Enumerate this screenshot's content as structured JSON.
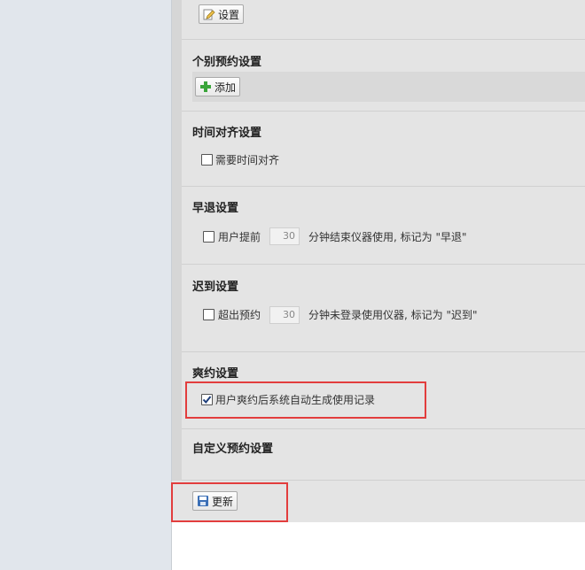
{
  "top": {
    "settings_button": "设置"
  },
  "individual": {
    "title": "个别预约设置",
    "add_button": "添加"
  },
  "time_align": {
    "title": "时间对齐设置",
    "checkbox_label": "需要时间对齐",
    "checked": false
  },
  "early_leave": {
    "title": "早退设置",
    "prefix": "用户提前",
    "minutes": "30",
    "suffix": "分钟结束仪器使用, 标记为 \"早退\"",
    "checked": false
  },
  "late": {
    "title": "迟到设置",
    "prefix": "超出预约",
    "minutes": "30",
    "suffix": "分钟未登录使用仪器, 标记为 \"迟到\"",
    "checked": false
  },
  "no_show": {
    "title": "爽约设置",
    "checkbox_label": "用户爽约后系统自动生成使用记录",
    "checked": true
  },
  "custom": {
    "title": "自定义预约设置"
  },
  "footer": {
    "update_button": "更新"
  },
  "colors": {
    "highlight": "#e23d3d",
    "add_icon": "#3aa53a",
    "save_icon": "#3b6fb6"
  }
}
